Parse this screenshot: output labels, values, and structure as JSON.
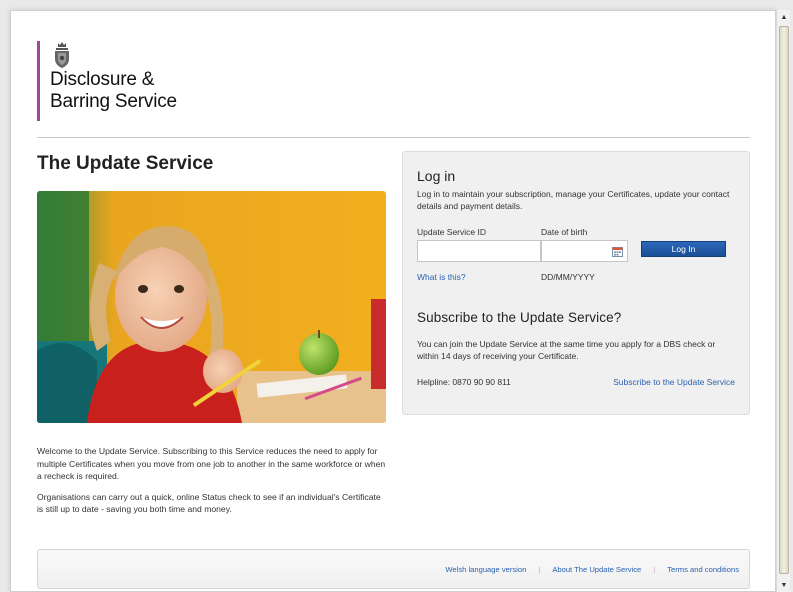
{
  "header": {
    "logo_line1": "Disclosure &",
    "logo_line2": "Barring Service"
  },
  "page": {
    "title": "The Update Service",
    "intro_p1": "Welcome to the Update Service. Subscribing to this Service reduces the need to apply for multiple Certificates when you move from one job to another in the same workforce or when a recheck is required.",
    "intro_p2": "Organisations can carry out a quick, online Status check to see if an individual's Certificate is still up to date - saving you both time and money."
  },
  "login": {
    "title": "Log in",
    "description": "Log in to maintain your subscription, manage your Certificates, update your contact details and payment details.",
    "id_label": "Update Service ID",
    "dob_label": "Date of birth",
    "id_value": "",
    "dob_value": "",
    "button_label": "Log In",
    "what_link": "What is this?",
    "dob_format": "DD/MM/YYYY"
  },
  "subscribe": {
    "title": "Subscribe to the Update Service?",
    "description": "You can join the Update Service at the same time you apply for a DBS check or within 14 days of receiving your Certificate.",
    "helpline": "Helpline: 0870 90 90 811",
    "link": "Subscribe to the Update Service"
  },
  "footer": {
    "links": [
      "Welsh language version",
      "About The Update Service",
      "Terms and conditions"
    ],
    "separator": "|"
  },
  "colors": {
    "brand_purple": "#a0469b",
    "link_blue": "#2a62b1",
    "button_blue": "#1f58a6"
  },
  "icons": {
    "crest": "royal-crest-icon",
    "calendar": "calendar-icon",
    "scroll_up": "scroll-up-arrow-icon",
    "scroll_down": "scroll-down-arrow-icon"
  }
}
